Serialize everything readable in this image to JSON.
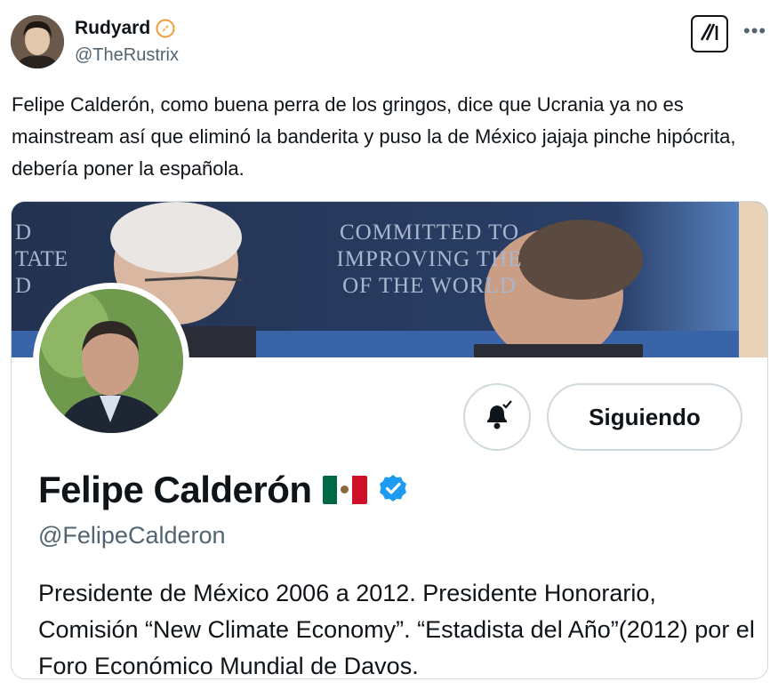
{
  "author": {
    "display_name": "Rudyard",
    "handle": "@TheRustrix"
  },
  "tweet": {
    "text": "Felipe Calderón, como buena perra de los gringos, dice que Ucrania ya no es mainstream así que eliminó la banderita y puso la de México jajaja pinche hipócrita, debería poner la española."
  },
  "embedded_profile": {
    "banner_text": [
      "COMMITTED TO",
      "IMPROVING THE",
      "OF THE WORLD"
    ],
    "banner_side_text": [
      "D",
      "TATE",
      "D"
    ],
    "follow_label": "Siguiendo",
    "name": "Felipe Calderón",
    "handle": "@FelipeCalderon",
    "bio": "Presidente de México 2006 a 2012. Presidente Honorario, Comisión “New Climate Economy”. “Estadista del Año”(2012) por el Foro Económico Mundial de Davos.",
    "flag_colors": [
      "#006847",
      "#ffffff",
      "#ce1126"
    ],
    "verified_color": "#1d9bf0"
  },
  "icons": {
    "badge": "compass-badge-icon",
    "more": "more-icon",
    "grok": "grok-icon",
    "bell": "bell-check-icon",
    "verified": "verified-badge-icon"
  }
}
